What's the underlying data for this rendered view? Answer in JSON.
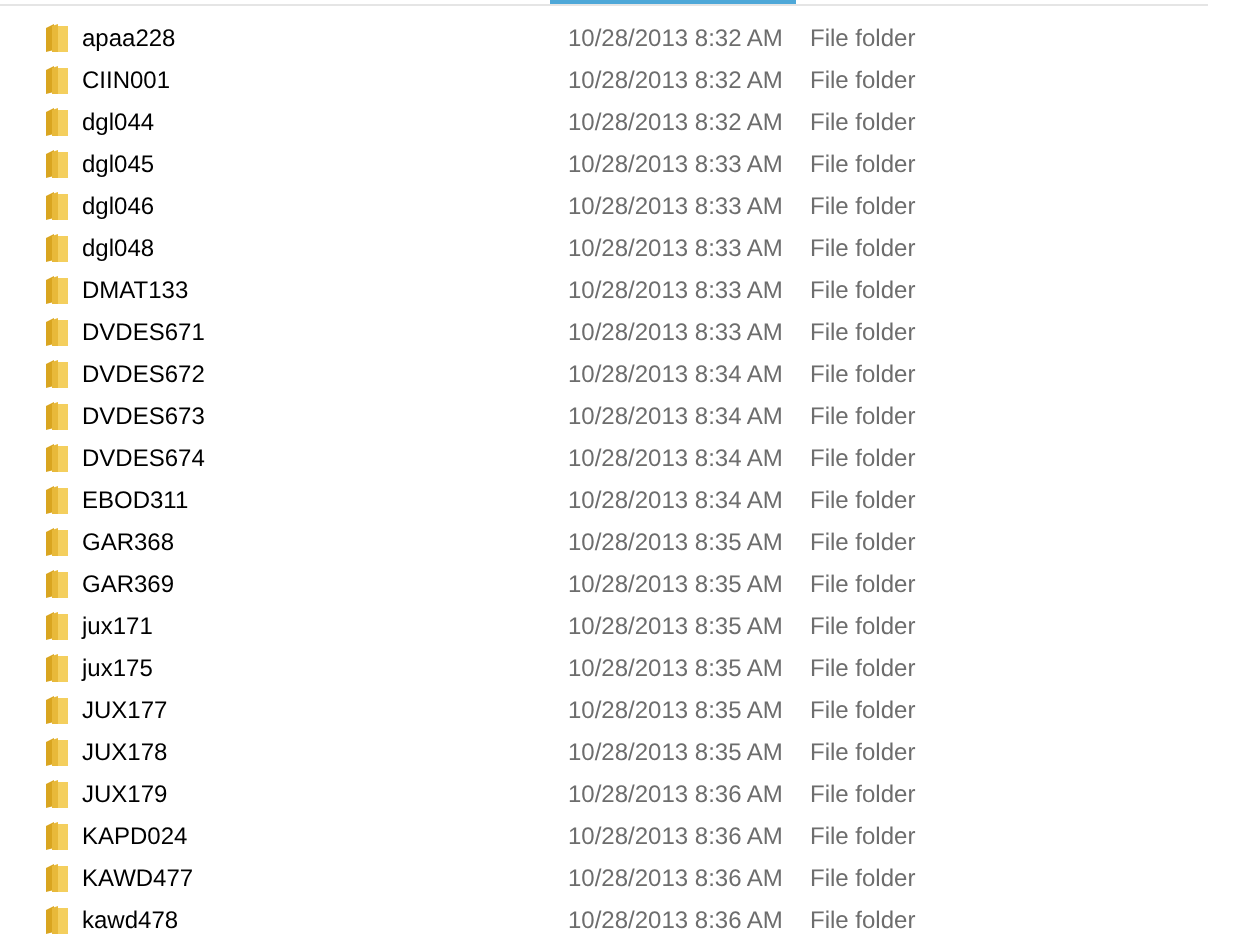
{
  "rows": [
    {
      "name": "apaa228",
      "date_modified": "10/28/2013 8:32 AM",
      "type": "File folder"
    },
    {
      "name": "CIIN001",
      "date_modified": "10/28/2013 8:32 AM",
      "type": "File folder"
    },
    {
      "name": "dgl044",
      "date_modified": "10/28/2013 8:32 AM",
      "type": "File folder"
    },
    {
      "name": "dgl045",
      "date_modified": "10/28/2013 8:33 AM",
      "type": "File folder"
    },
    {
      "name": "dgl046",
      "date_modified": "10/28/2013 8:33 AM",
      "type": "File folder"
    },
    {
      "name": "dgl048",
      "date_modified": "10/28/2013 8:33 AM",
      "type": "File folder"
    },
    {
      "name": "DMAT133",
      "date_modified": "10/28/2013 8:33 AM",
      "type": "File folder"
    },
    {
      "name": "DVDES671",
      "date_modified": "10/28/2013 8:33 AM",
      "type": "File folder"
    },
    {
      "name": "DVDES672",
      "date_modified": "10/28/2013 8:34 AM",
      "type": "File folder"
    },
    {
      "name": "DVDES673",
      "date_modified": "10/28/2013 8:34 AM",
      "type": "File folder"
    },
    {
      "name": "DVDES674",
      "date_modified": "10/28/2013 8:34 AM",
      "type": "File folder"
    },
    {
      "name": "EBOD311",
      "date_modified": "10/28/2013 8:34 AM",
      "type": "File folder"
    },
    {
      "name": "GAR368",
      "date_modified": "10/28/2013 8:35 AM",
      "type": "File folder"
    },
    {
      "name": "GAR369",
      "date_modified": "10/28/2013 8:35 AM",
      "type": "File folder"
    },
    {
      "name": "jux171",
      "date_modified": "10/28/2013 8:35 AM",
      "type": "File folder"
    },
    {
      "name": "jux175",
      "date_modified": "10/28/2013 8:35 AM",
      "type": "File folder"
    },
    {
      "name": "JUX177",
      "date_modified": "10/28/2013 8:35 AM",
      "type": "File folder"
    },
    {
      "name": "JUX178",
      "date_modified": "10/28/2013 8:35 AM",
      "type": "File folder"
    },
    {
      "name": "JUX179",
      "date_modified": "10/28/2013 8:36 AM",
      "type": "File folder"
    },
    {
      "name": "KAPD024",
      "date_modified": "10/28/2013 8:36 AM",
      "type": "File folder"
    },
    {
      "name": "KAWD477",
      "date_modified": "10/28/2013 8:36 AM",
      "type": "File folder"
    },
    {
      "name": "kawd478",
      "date_modified": "10/28/2013 8:36 AM",
      "type": "File folder"
    }
  ]
}
